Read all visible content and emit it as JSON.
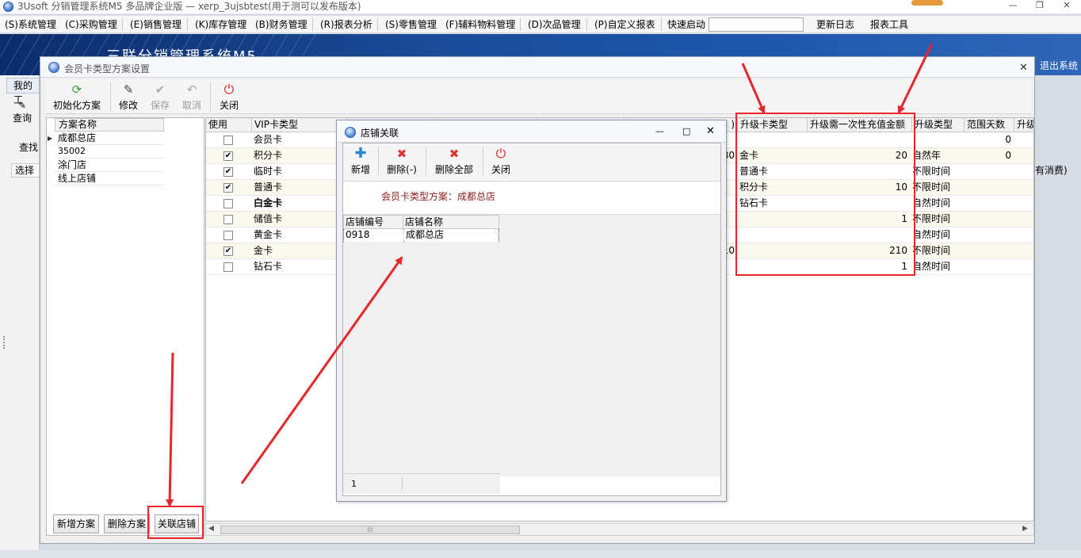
{
  "app": {
    "window_title": "3Usoft 分销管理系统M5 多品牌企业版 — xerp_3ujsbtest(用于测可以发布版本)",
    "banner_title": "三联分销管理系统M5",
    "exit_label": "退出系统"
  },
  "menu": {
    "items": [
      {
        "label": "(S)系统管理"
      },
      {
        "label": "(C)采购管理"
      },
      {
        "label": "(E)销售管理"
      },
      {
        "label": "(K)库存管理"
      },
      {
        "label": "(B)财务管理"
      },
      {
        "label": "(R)报表分析"
      },
      {
        "label": "(S)零售管理"
      },
      {
        "label": "(F)辅料物料管理"
      },
      {
        "label": "(D)次品管理"
      },
      {
        "label": "(P)自定义报表"
      }
    ],
    "quick_start_label": "快速启动",
    "quick_start_value": "",
    "update_log": "更新日志",
    "report_tool": "报表工具"
  },
  "background": {
    "tab_mine": "我的工",
    "query_label": "查询",
    "find_label": "查找",
    "select_header": "选择",
    "right_partial": "有消费)"
  },
  "dialog_scheme": {
    "title": "会员卡类型方案设置",
    "toolbar": {
      "init": "初始化方案",
      "edit": "修改",
      "save": "保存",
      "cancel": "取消",
      "close": "关闭"
    },
    "scheme_list": {
      "header": "方案名称",
      "rows": [
        "成都总店",
        "35002",
        "涂门店",
        "线上店铺"
      ]
    },
    "buttons": {
      "add": "新增方案",
      "delete": "删除方案",
      "link_store": "关联店铺"
    },
    "grid": {
      "columns": [
        "使用",
        "VIP卡类型",
        ")",
        "升级卡类型",
        "升级需一次性充值金额",
        "升级类型",
        "范围天数",
        "升级"
      ],
      "rows": [
        {
          "use": false,
          "type": "会员卡",
          "partial": "",
          "upgrade_card": "",
          "amount": "",
          "upgrade_type": "",
          "days": "0",
          "bold": false
        },
        {
          "use": true,
          "type": "积分卡",
          "partial": "80",
          "upgrade_card": "金卡",
          "amount": "20",
          "upgrade_type": "自然年",
          "days": "0",
          "bold": false
        },
        {
          "use": true,
          "type": "临时卡",
          "partial": "",
          "upgrade_card": "普通卡",
          "amount": "",
          "upgrade_type": "不限时间",
          "days": "",
          "bold": false
        },
        {
          "use": true,
          "type": "普通卡",
          "partial": "",
          "upgrade_card": "积分卡",
          "amount": "10",
          "upgrade_type": "不限时间",
          "days": "",
          "bold": false
        },
        {
          "use": false,
          "type": "白金卡",
          "partial": "",
          "upgrade_card": "钻石卡",
          "amount": "",
          "upgrade_type": "自然时间",
          "days": "",
          "bold": true
        },
        {
          "use": false,
          "type": "储值卡",
          "partial": "",
          "upgrade_card": "",
          "amount": "1",
          "upgrade_type": "不限时间",
          "days": "",
          "bold": false
        },
        {
          "use": false,
          "type": "黄金卡",
          "partial": "",
          "upgrade_card": "",
          "amount": "",
          "upgrade_type": "自然时间",
          "days": "",
          "bold": false
        },
        {
          "use": true,
          "type": "金卡",
          "partial": "10",
          "upgrade_card": "",
          "amount": "210",
          "upgrade_type": "不限时间",
          "days": "",
          "bold": false
        },
        {
          "use": false,
          "type": "钻石卡",
          "partial": "",
          "upgrade_card": "",
          "amount": "1",
          "upgrade_type": "自然时间",
          "days": "",
          "bold": false
        }
      ]
    }
  },
  "dialog_store": {
    "title": "店铺关联",
    "toolbar": {
      "add": "新增",
      "delete": "删除(-)",
      "delete_all": "删除全部",
      "close": "关闭"
    },
    "scheme_label": "会员卡类型方案：成都总店",
    "grid": {
      "columns": [
        "店铺编号",
        "店铺名称"
      ],
      "rows": [
        {
          "code": "0918",
          "name": "成都总店"
        }
      ]
    },
    "footer_count": "1"
  },
  "colors": {
    "annotation_red": "#e8262b",
    "banner_blue": "#1b4b98",
    "scheme_label": "#8b1c1c"
  }
}
